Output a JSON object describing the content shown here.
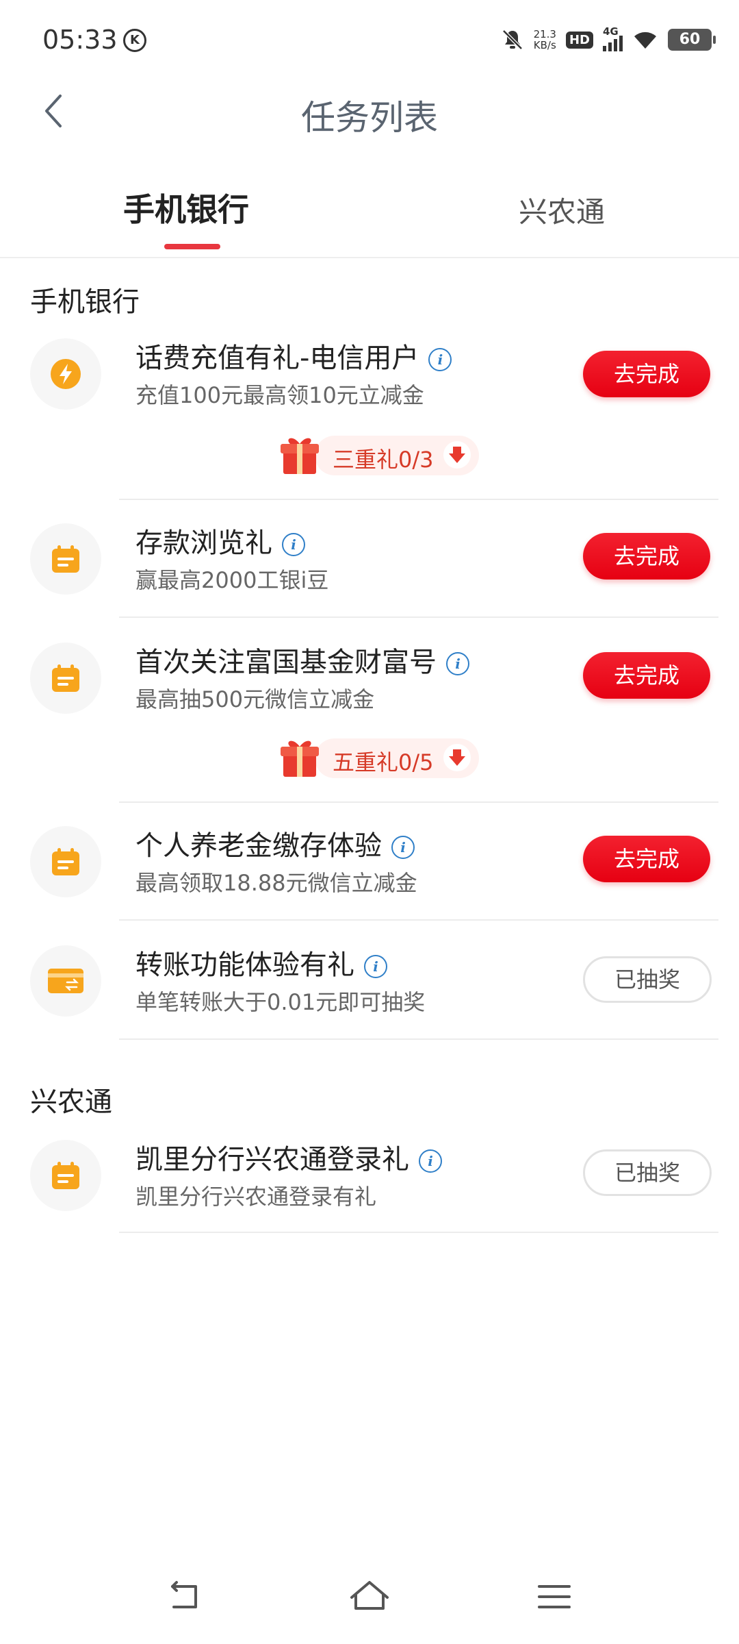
{
  "status": {
    "time": "05:33",
    "speed_top": "21.3",
    "speed_bottom": "KB/s",
    "hd": "HD",
    "network": "4G",
    "battery": "60"
  },
  "header": {
    "title": "任务列表"
  },
  "tabs": [
    {
      "label": "手机银行"
    },
    {
      "label": "兴农通"
    }
  ],
  "sections": [
    {
      "title": "手机银行"
    },
    {
      "title": "兴农通"
    }
  ],
  "tasks": [
    {
      "name": "话费充值有礼-电信用户",
      "desc": "充值100元最高领10元立减金",
      "button": "去完成",
      "icon": "lightning-icon"
    },
    {
      "name": "存款浏览礼",
      "desc": "赢最高2000工银i豆",
      "button": "去完成",
      "icon": "calendar-icon"
    },
    {
      "name": "首次关注富国基金财富号",
      "desc": "最高抽500元微信立减金",
      "button": "去完成",
      "icon": "calendar-icon"
    },
    {
      "name": "个人养老金缴存体验",
      "desc": "最高领取18.88元微信立减金",
      "button": "去完成",
      "icon": "calendar-icon"
    },
    {
      "name": "转账功能体验有礼",
      "desc": "单笔转账大于0.01元即可抽奖",
      "button": "已抽奖",
      "icon": "card-transfer-icon"
    },
    {
      "name": "凯里分行兴农通登录礼",
      "desc": "凯里分行兴农通登录有礼",
      "button": "已抽奖",
      "icon": "calendar-icon"
    }
  ],
  "gifts": [
    {
      "label": "三重礼0/3"
    },
    {
      "label": "五重礼0/5"
    }
  ],
  "info_glyph": "i",
  "colors": {
    "accent_red": "#e60012",
    "icon_orange": "#f7a51c",
    "info_blue": "#2f7fc8",
    "tab_underline": "#e8373f"
  }
}
